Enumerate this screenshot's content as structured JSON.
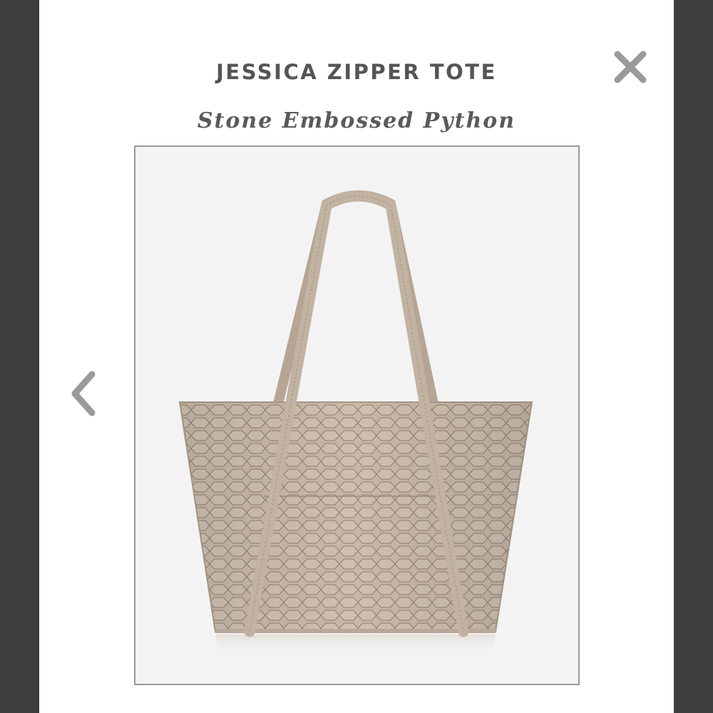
{
  "modal": {
    "title": "JESSICA ZIPPER TOTE",
    "subtitle": "Stone Embossed Python"
  },
  "icons": {
    "close": "close-icon",
    "previous": "chevron-left-icon"
  },
  "product_image": {
    "alt": "Jessica Zipper Tote in Stone Embossed Python"
  },
  "colors": {
    "backdrop": "#3d3d3d",
    "modal_bg": "#ffffff",
    "text": "#555555",
    "icon": "#9a9a9a",
    "leather": "#c5b5a5",
    "frame_border": "#9a9a9a"
  }
}
